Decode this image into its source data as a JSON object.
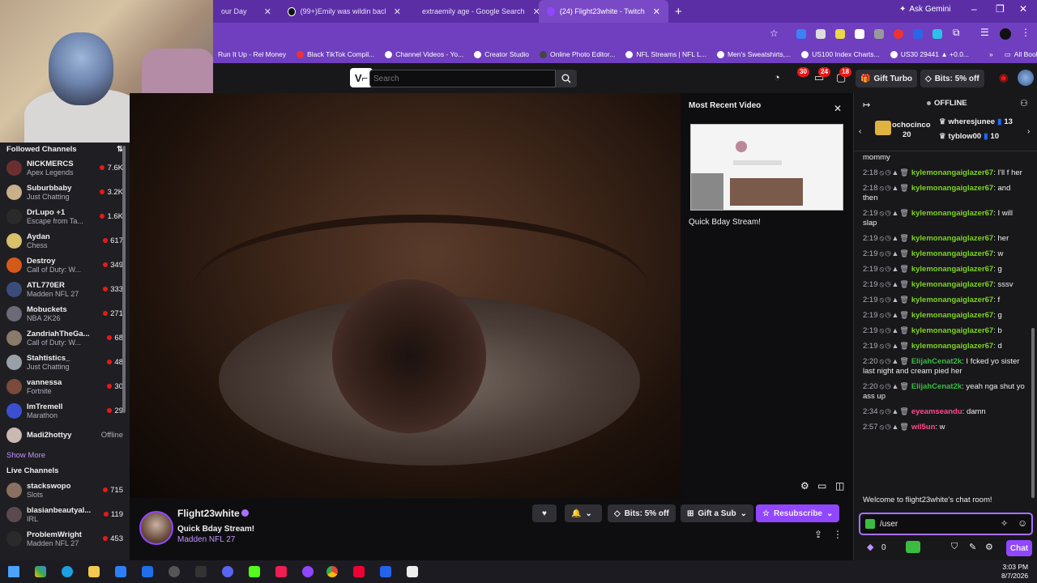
{
  "browser": {
    "tabs": [
      {
        "label": "our Day"
      },
      {
        "label": "(99+)Emily was wildin back the"
      },
      {
        "label": "extraemily age - Google Search"
      },
      {
        "label": "(24) Flight23white - Twitch"
      }
    ],
    "ask_gemini": "Ask Gemini",
    "bookmarks": [
      "Run It Up - Rel Money",
      "Black TikTok Compil...",
      "Channel Videos - Yo...",
      "Creator Studio",
      "Online Photo Editor...",
      "NFL Streams | NFL L...",
      "Men's Sweatshirts,...",
      "US100 Index Charts...",
      "US30 29441 ▲ +0.0..."
    ],
    "all_bookmarks": "All Bookmarks"
  },
  "nav": {
    "search_placeholder": "Search",
    "badges": {
      "a": "30",
      "b": "24",
      "c": "18"
    },
    "gift_turbo": "Gift Turbo",
    "bits": "Bits: 5% off"
  },
  "sidebar": {
    "followed_title": "Followed Channels",
    "followed": [
      {
        "name": "NICKMERCS",
        "game": "Apex Legends",
        "viewers": "7.6K",
        "color": "#6b2f2f"
      },
      {
        "name": "Suburbbaby",
        "game": "Just Chatting",
        "viewers": "3.2K",
        "color": "#c8b08a"
      },
      {
        "name": "DrLupo +1",
        "game": "Escape from Ta...",
        "viewers": "1.6K",
        "color": "#2a2a2a"
      },
      {
        "name": "Aydan",
        "game": "Chess",
        "viewers": "617",
        "color": "#d9c06a"
      },
      {
        "name": "Destroy",
        "game": "Call of Duty: W...",
        "viewers": "349",
        "color": "#d55a1a"
      },
      {
        "name": "ATL770ER",
        "game": "Madden NFL 27",
        "viewers": "333",
        "color": "#3a4c7a"
      },
      {
        "name": "Mobuckets",
        "game": "NBA 2K26",
        "viewers": "271",
        "color": "#6a6a78"
      },
      {
        "name": "ZandriahTheGa...",
        "game": "Call of Duty: W...",
        "viewers": "68",
        "color": "#8a7a6a"
      },
      {
        "name": "Stahtistics_",
        "game": "Just Chatting",
        "viewers": "48",
        "color": "#9aa0a8"
      },
      {
        "name": "vannessa",
        "game": "Fortnite",
        "viewers": "30",
        "color": "#7a4a3a"
      },
      {
        "name": "ImTremell",
        "game": "Marathon",
        "viewers": "29",
        "color": "#3b4fd0"
      },
      {
        "name": "Madi2hottyy",
        "game": "",
        "viewers": "Offline",
        "color": "#c9b9b0"
      }
    ],
    "show_more": "Show More",
    "live_title": "Live Channels",
    "live": [
      {
        "name": "stackswopo",
        "game": "Slots",
        "viewers": "715",
        "color": "#8a7060"
      },
      {
        "name": "blasianbeautyal...",
        "game": "IRL",
        "viewers": "119",
        "color": "#5a4a50"
      },
      {
        "name": "ProblemWright",
        "game": "Madden NFL 27",
        "viewers": "453",
        "color": "#2a2a2a"
      }
    ]
  },
  "recent": {
    "title": "Most Recent Video",
    "caption": "Quick Bday Stream!"
  },
  "channel": {
    "name": "Flight23white",
    "title": "Quick Bday Stream!",
    "game": "Madden NFL 27",
    "bits_btn": "Bits: 5% off",
    "gift_sub": "Gift a Sub",
    "subscribe": "Resubscribe"
  },
  "chat": {
    "status": "OFFLINE",
    "leaderboard": {
      "gift_user": "ochocinco",
      "gift_count": "20",
      "top1_user": "wheresjunee",
      "top1_count": "13",
      "top2_user": "tyblow00",
      "top2_count": "10"
    },
    "messages": [
      {
        "ts": "",
        "user": "",
        "text": "mommy",
        "color": "#efeff1"
      },
      {
        "ts": "2:18",
        "user": "kylemonangaiglazer67",
        "text": ": I'll f her",
        "color": "#7ed321"
      },
      {
        "ts": "2:18",
        "user": "kylemonangaiglazer67",
        "text": ": and then",
        "color": "#7ed321"
      },
      {
        "ts": "2:19",
        "user": "kylemonangaiglazer67",
        "text": ": I will slap",
        "color": "#7ed321"
      },
      {
        "ts": "2:19",
        "user": "kylemonangaiglazer67",
        "text": ": her",
        "color": "#7ed321"
      },
      {
        "ts": "2:19",
        "user": "kylemonangaiglazer67",
        "text": ": w",
        "color": "#7ed321"
      },
      {
        "ts": "2:19",
        "user": "kylemonangaiglazer67",
        "text": ": g",
        "color": "#7ed321"
      },
      {
        "ts": "2:19",
        "user": "kylemonangaiglazer67",
        "text": ": sssv",
        "color": "#7ed321"
      },
      {
        "ts": "2:19",
        "user": "kylemonangaiglazer67",
        "text": ": f",
        "color": "#7ed321"
      },
      {
        "ts": "2:19",
        "user": "kylemonangaiglazer67",
        "text": ": g",
        "color": "#7ed321"
      },
      {
        "ts": "2:19",
        "user": "kylemonangaiglazer67",
        "text": ": b",
        "color": "#7ed321"
      },
      {
        "ts": "2:19",
        "user": "kylemonangaiglazer67",
        "text": ": d",
        "color": "#7ed321"
      },
      {
        "ts": "2:20",
        "user": "ElijahCenat2k",
        "text": ": I fcked yo sister last night and cream pied her",
        "color": "#3bbb42"
      },
      {
        "ts": "2:20",
        "user": "ElijahCenat2k",
        "text": ": yeah nga shut yo ass up",
        "color": "#3bbb42"
      },
      {
        "ts": "2:34",
        "user": "eyeamseandu",
        "text": ": damn",
        "color": "#ff4b8b"
      },
      {
        "ts": "2:57",
        "user": "wil5un",
        "text": ": w",
        "color": "#ff4b8b"
      }
    ],
    "welcome": "Welcome to flight23white's chat room!",
    "input_value": "/user",
    "points": "0",
    "send": "Chat"
  },
  "taskbar": {
    "time": "3:03 PM",
    "date": "8/7/2026"
  }
}
